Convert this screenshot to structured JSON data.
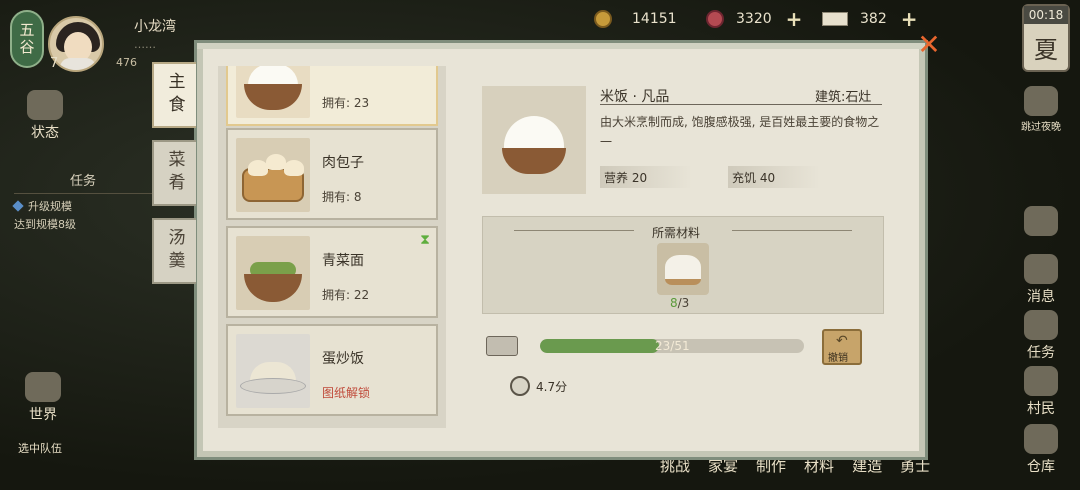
{
  "hud": {
    "season_badge": "五谷",
    "level": "7",
    "player_name": "小龙湾",
    "player_sub": "……",
    "player_sub2": "476",
    "coins": "14151",
    "gems": "3320",
    "tickets": "382",
    "time": "00:18",
    "season": "夏"
  },
  "left_sidebar": {
    "status": "状态",
    "task_title": "任务",
    "task_line1": "升级规模",
    "task_line2": "达到规模8级",
    "world": "世界",
    "team": "选中队伍"
  },
  "right_sidebar": {
    "skip_night": "跳过夜晚",
    "rest": "消息",
    "task": "任务",
    "villager": "村民",
    "warehouse": "仓库"
  },
  "bottom_bar": [
    "挑战",
    "家宴",
    "制作",
    "材料",
    "建造",
    "勇士"
  ],
  "tabs": [
    "主食",
    "菜肴",
    "汤羹"
  ],
  "items": [
    {
      "name": "",
      "owned": "拥有: 23"
    },
    {
      "name": "肉包子",
      "owned": "拥有: 8"
    },
    {
      "name": "青菜面",
      "owned": "拥有: 22"
    },
    {
      "name": "蛋炒饭",
      "owned": "图纸解锁"
    }
  ],
  "detail": {
    "title": "米饭 · 凡品",
    "building": "建筑:石灶",
    "description": "由大米烹制而成, 饱腹感极强, 是百姓最主要的食物之一",
    "stat_nutrition": "营养 20",
    "stat_hunger": "充饥 40",
    "materials_title": "所需材料",
    "material_have": "8",
    "material_need": "/3",
    "progress_text": "23/51",
    "progress_value": 0.45,
    "undo_label": "撤销",
    "time": "4.7分"
  },
  "close": "✕"
}
